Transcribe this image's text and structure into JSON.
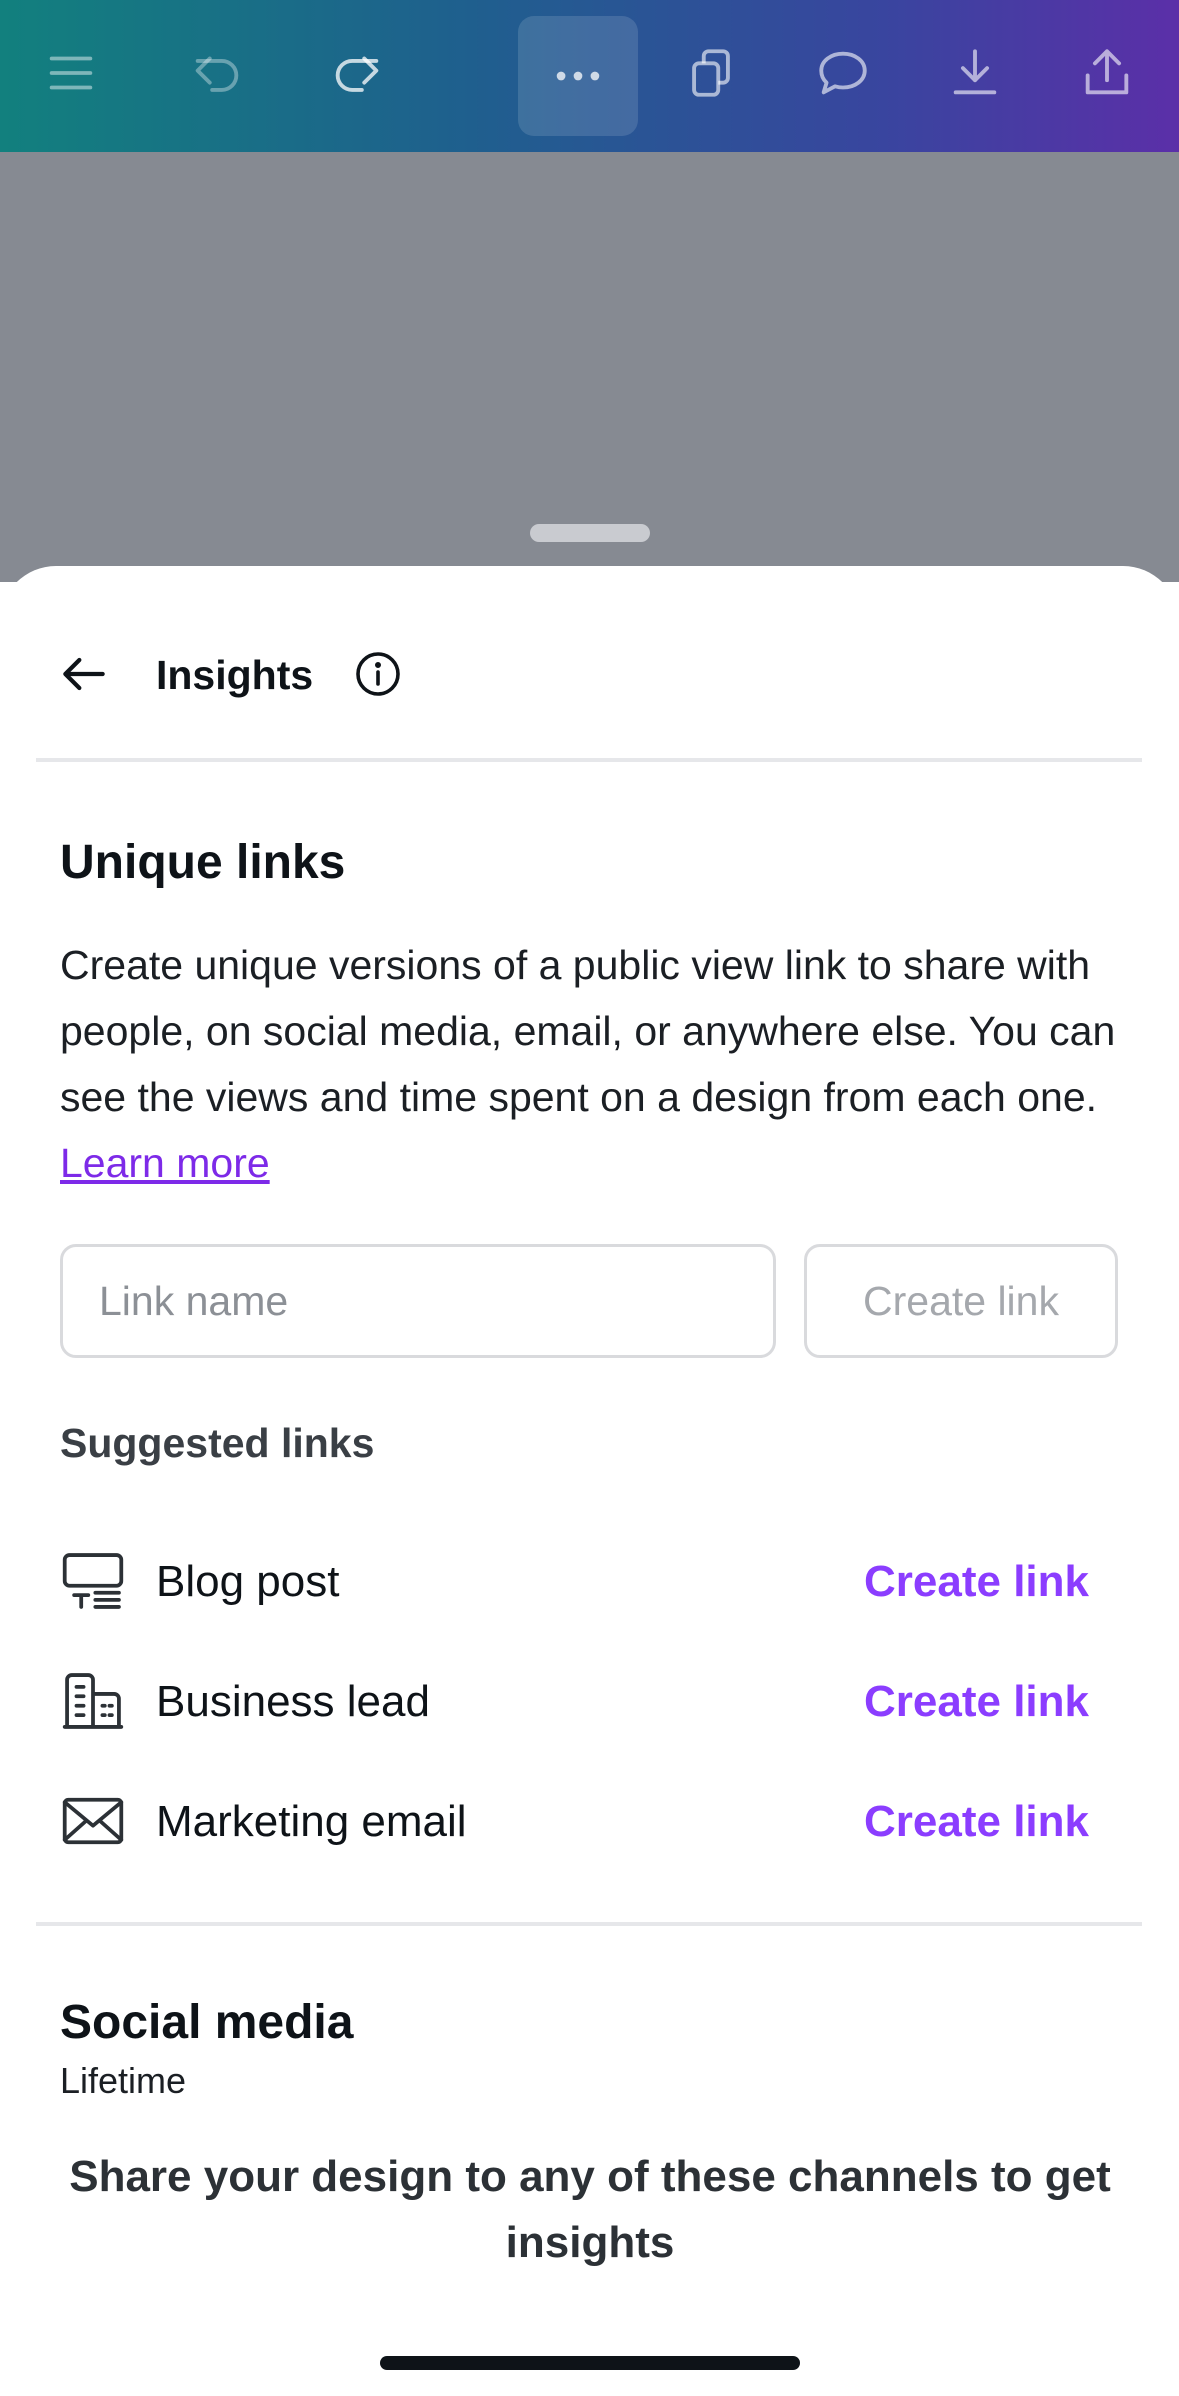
{
  "toolbar": {
    "icons": [
      "menu-icon",
      "undo-icon",
      "redo-icon",
      "more-icon",
      "pages-icon",
      "comment-icon",
      "download-icon",
      "share-icon"
    ]
  },
  "header": {
    "title": "Insights"
  },
  "unique_links": {
    "title": "Unique links",
    "description": "Create unique versions of a public view link to share with people, on social media, email, or anywhere else. You can see the views and time spent on a design from each one.",
    "learn_more": "Learn more",
    "input_placeholder": "Link name",
    "create_button": "Create link"
  },
  "suggested": {
    "title": "Suggested links",
    "items": [
      {
        "label": "Blog post",
        "action": "Create link",
        "icon": "billboard-icon"
      },
      {
        "label": "Business lead",
        "action": "Create link",
        "icon": "building-icon"
      },
      {
        "label": "Marketing email",
        "action": "Create link",
        "icon": "envelope-icon"
      }
    ]
  },
  "social_media": {
    "title": "Social media",
    "period": "Lifetime",
    "message": "Share your design to any of these channels to get insights"
  },
  "colors": {
    "accent": "#8b3dff",
    "link": "#7d2ae8",
    "canvas_bg": "#868a92"
  }
}
